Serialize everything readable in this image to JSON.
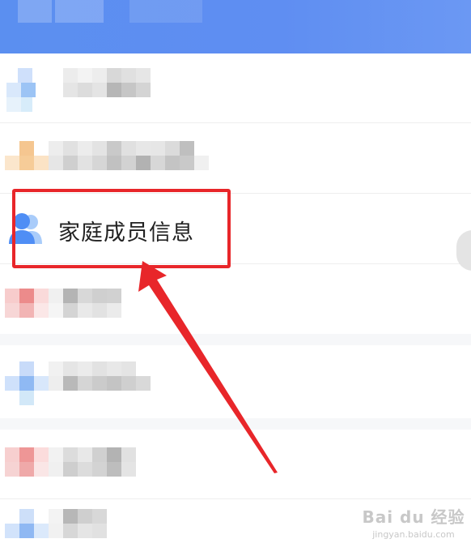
{
  "menu": {
    "family_info_label": "家庭成员信息",
    "family_icon": "family-members-icon"
  },
  "watermark": {
    "brand": "Bai du 经验",
    "url": "jingyan.baidu.com"
  },
  "colors": {
    "header": "#5b8ff0",
    "highlight": "#e8262a",
    "icon_blue": "#4f8ef5"
  }
}
